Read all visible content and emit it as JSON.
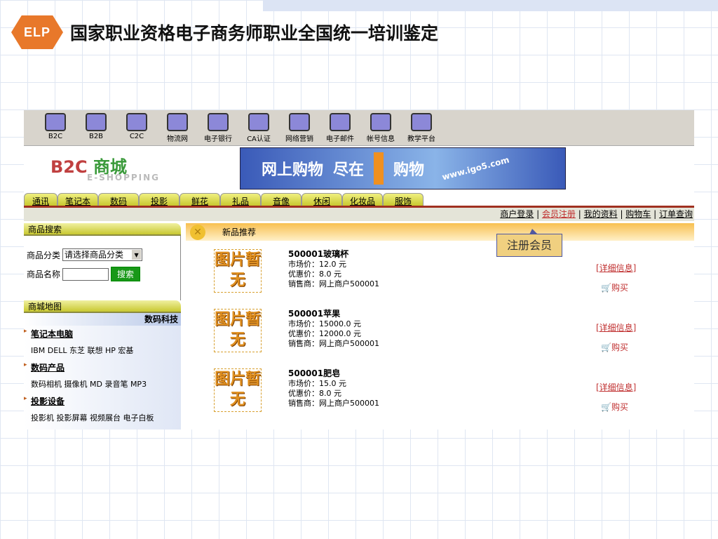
{
  "page": {
    "title": "国家职业资格电子商务师职业全国统一培训鉴定",
    "logo_text": "ELP"
  },
  "toolbar": [
    "B2C",
    "B2B",
    "C2C",
    "物流网",
    "电子银行",
    "CA认证",
    "网络营销",
    "电子邮件",
    "帐号信息",
    "教学平台"
  ],
  "banner": {
    "brand": "B2C",
    "brand2": "商城",
    "sub": "E-SHOPPING",
    "ad": [
      "网上购物",
      "尽在",
      "购物"
    ],
    "url": "www.igo5.com"
  },
  "tabs": [
    "通讯",
    "笔记本",
    "数码",
    "投影",
    "鲜花",
    "礼品",
    "音像",
    "休闲",
    "化妆品",
    "服饰"
  ],
  "links": [
    "商户登录",
    "会员注册",
    "我的资料",
    "购物车",
    "订单查询"
  ],
  "tooltip": "注册会员",
  "search": {
    "header": "商品搜索",
    "cat_label": "商品分类",
    "cat_value": "请选择商品分类",
    "name_label": "商品名称",
    "button": "搜索"
  },
  "map": {
    "header": "商城地图",
    "category": "数码科技",
    "groups": [
      {
        "title": "笔记本电脑",
        "items": "IBM DELL 东芝 联想 HP 宏基"
      },
      {
        "title": "数码产品",
        "items": "数码相机 摄像机 MD 录音笔 MP3"
      },
      {
        "title": "投影设备",
        "items": "投影机 投影屏幕 视频展台 电子白板"
      }
    ]
  },
  "products": {
    "header": "新品推荐",
    "img_text": "图片暂无",
    "detail": "[详细信息]",
    "buy": "购买",
    "items": [
      {
        "name": "500001玻璃杯",
        "market": "市场价：12.0 元",
        "price": "优惠价：8.0 元",
        "seller": "销售商：网上商户500001"
      },
      {
        "name": "500001苹果",
        "market": "市场价：15000.0 元",
        "price": "优惠价：12000.0 元",
        "seller": "销售商：网上商户500001"
      },
      {
        "name": "500001肥皂",
        "market": "市场价：15.0 元",
        "price": "优惠价：8.0 元",
        "seller": "销售商：网上商户500001"
      }
    ]
  }
}
